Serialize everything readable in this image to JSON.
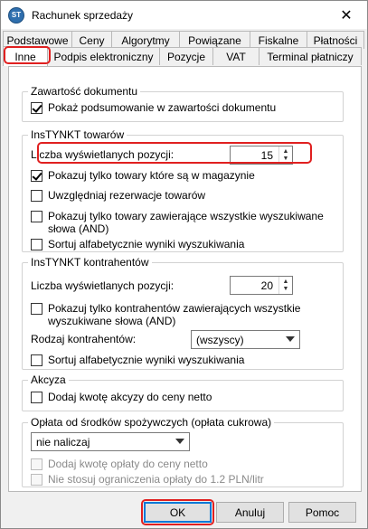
{
  "window": {
    "title": "Rachunek sprzedaży",
    "close_label": "✕",
    "icon_text": "ST"
  },
  "tabs": {
    "row1": [
      "Podstawowe",
      "Ceny",
      "Algorytmy",
      "Powiązane",
      "Fiskalne",
      "Płatności"
    ],
    "row2": [
      "Inne",
      "Podpis elektroniczny",
      "Pozycje",
      "VAT",
      "Terminal płatniczy"
    ],
    "active": "Inne"
  },
  "doc_contents": {
    "title": "Zawartość dokumentu",
    "show_summary": {
      "label": "Pokaż podsumowanie w zawartości dokumentu",
      "checked": true
    }
  },
  "instynkt_goods": {
    "title": "InsTYNKT towarów",
    "count_label": "Liczba wyświetlanych pozycji:",
    "count_value": "15",
    "only_in_stock": {
      "label": "Pokazuj tylko towary które są w magazynie",
      "checked": true
    },
    "include_reservations": {
      "label": "Uwzględniaj rezerwacje towarów",
      "checked": false
    },
    "all_words_line1": "Pokazuj tylko towary zawierające wszystkie wyszukiwane",
    "all_words_line2": "słowa (AND)",
    "sort_alpha": {
      "label": "Sortuj alfabetycznie wyniki wyszukiwania",
      "checked": false
    }
  },
  "instynkt_contractors": {
    "title": "InsTYNKT kontrahentów",
    "count_label": "Liczba wyświetlanych pozycji:",
    "count_value": "20",
    "all_words_line1": "Pokazuj tylko kontrahentów zawierających wszystkie",
    "all_words_line2": "wyszukiwane słowa (AND)",
    "type_label": "Rodzaj kontrahentów:",
    "type_value": "(wszyscy)",
    "sort_alpha": {
      "label": "Sortuj alfabetycznie wyniki wyszukiwania",
      "checked": false
    }
  },
  "excise": {
    "title": "Akcyza",
    "add_to_net": {
      "label": "Dodaj kwotę akcyzy do ceny netto",
      "checked": false
    }
  },
  "sugar_fee": {
    "title": "Opłata od środków spożywczych (opłata cukrowa)",
    "mode_value": "nie naliczaj",
    "add_to_net": {
      "label": "Dodaj kwotę opłaty do ceny netto",
      "checked": false
    },
    "ignore_limit": {
      "label": "Nie stosuj ograniczenia opłaty do 1.2 PLN/litr",
      "checked": false
    }
  },
  "buttons": {
    "ok": "OK",
    "cancel": "Anuluj",
    "help": "Pomoc"
  },
  "colors": {
    "highlight": "#e02020",
    "accent": "#0078d7"
  }
}
